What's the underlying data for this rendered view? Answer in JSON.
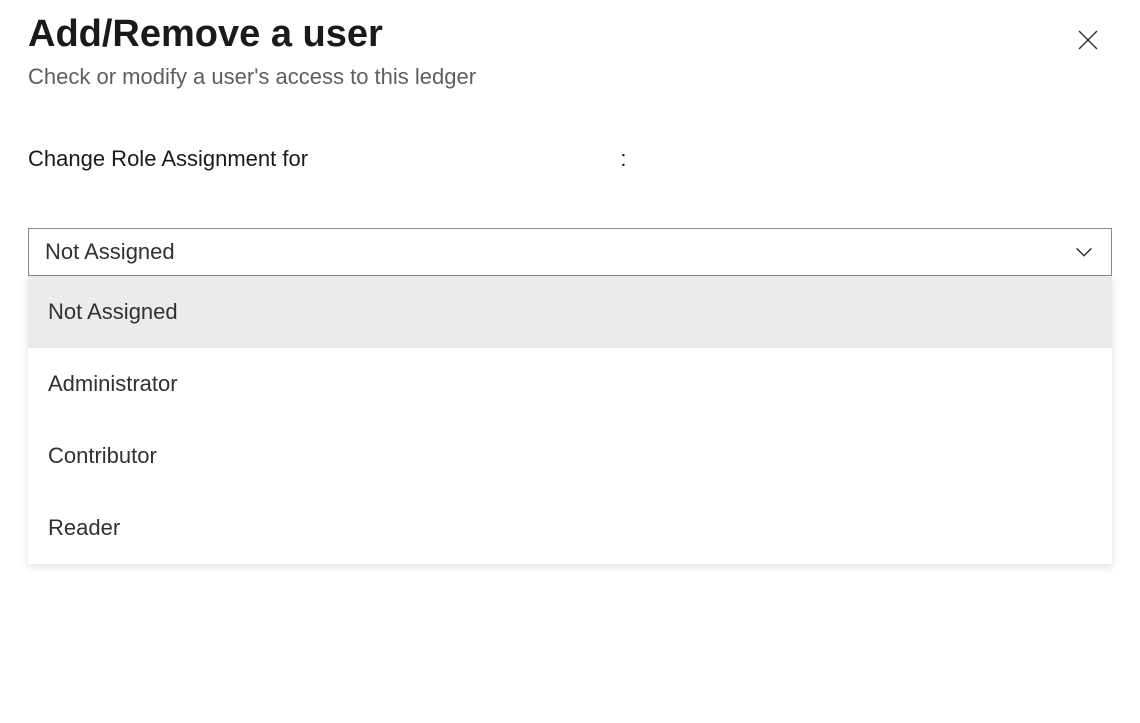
{
  "header": {
    "title": "Add/Remove a user",
    "subtitle": "Check or modify a user's access to this ledger",
    "close_label": "Close"
  },
  "field": {
    "label_prefix": "Change Role Assignment for",
    "user_value": "",
    "label_suffix": ":"
  },
  "dropdown": {
    "selected": "Not Assigned",
    "options": [
      "Not Assigned",
      "Administrator",
      "Contributor",
      "Reader"
    ],
    "selected_index": 0
  }
}
